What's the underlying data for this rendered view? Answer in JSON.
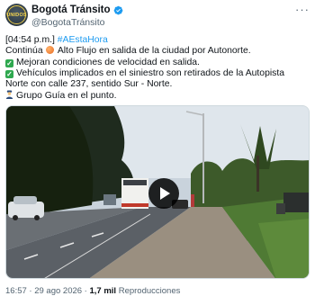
{
  "author": {
    "display_name": "Bogotá Tránsito",
    "handle": "@BogotaTránsito",
    "avatar_label": "UNIDOS"
  },
  "tweet": {
    "time": "[04:54 p.m.]",
    "hashtag": "#AEstaHora",
    "line1_prefix": "Continúa",
    "line1_suffix": "Alto Flujo en salida de la ciudad por Autonorte.",
    "line2": "Mejoran condiciones de  velocidad en salida.",
    "line3": "Vehículos implicados en el siniestro son retirados de la Autopista Norte con calle 237, sentido Sur - Norte.",
    "line4": "Grupo Guía en el punto."
  },
  "footer": {
    "time": "16:57 · 29 ago 2026 · ",
    "views": "1,7 mil",
    "views_label": " Reproducciones"
  },
  "colors": {
    "link": "#1d9bf0",
    "secondary_text": "#536471",
    "verified": "#1d9bf0"
  }
}
